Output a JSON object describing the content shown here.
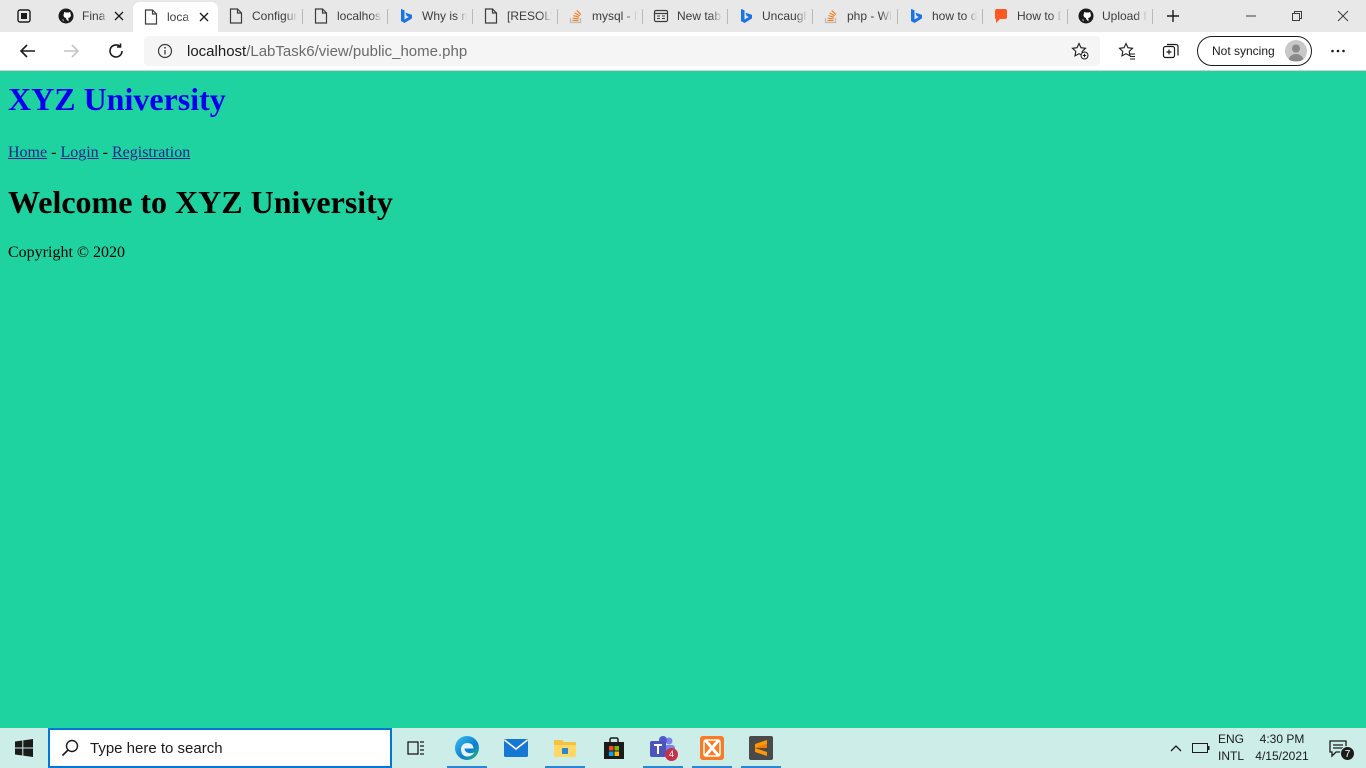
{
  "browser": {
    "tabs": [
      {
        "title": "Fina",
        "icon": "github-icon",
        "closable": true
      },
      {
        "title": "loca",
        "icon": "page-icon",
        "closable": true,
        "active": true
      },
      {
        "title": "Configur",
        "icon": "page-icon"
      },
      {
        "title": "localhost",
        "icon": "page-icon"
      },
      {
        "title": "Why is m",
        "icon": "bing-icon"
      },
      {
        "title": "[RESOLVI",
        "icon": "page-icon"
      },
      {
        "title": "mysql - F",
        "icon": "stackoverflow-icon"
      },
      {
        "title": "New tab",
        "icon": "newtab-icon"
      },
      {
        "title": "Uncaugh",
        "icon": "bing-icon"
      },
      {
        "title": "php - Wh",
        "icon": "stackoverflow-icon"
      },
      {
        "title": "how to d",
        "icon": "bing-icon"
      },
      {
        "title": "How to D",
        "icon": "blogger-icon"
      },
      {
        "title": "Upload f",
        "icon": "github-icon"
      }
    ],
    "url_host": "localhost",
    "url_path": "/LabTask6/view/public_home.php",
    "profile_label": "Not syncing"
  },
  "page": {
    "site_title": "XYZ University",
    "nav": {
      "home": "Home",
      "login": "Login",
      "registration": "Registration",
      "separator": " - "
    },
    "welcome": "Welcome to XYZ University",
    "copyright": "Copyright © 2020"
  },
  "taskbar": {
    "search_placeholder": "Type here to search",
    "teams_badge": "4",
    "lang_line1": "ENG",
    "lang_line2": "INTL",
    "time": "4:30 PM",
    "date": "4/15/2021",
    "notification_count": "7"
  },
  "colors": {
    "page_background": "#1fd3a0",
    "site_title": "#0000ee",
    "taskbar": "#cdeee8"
  }
}
